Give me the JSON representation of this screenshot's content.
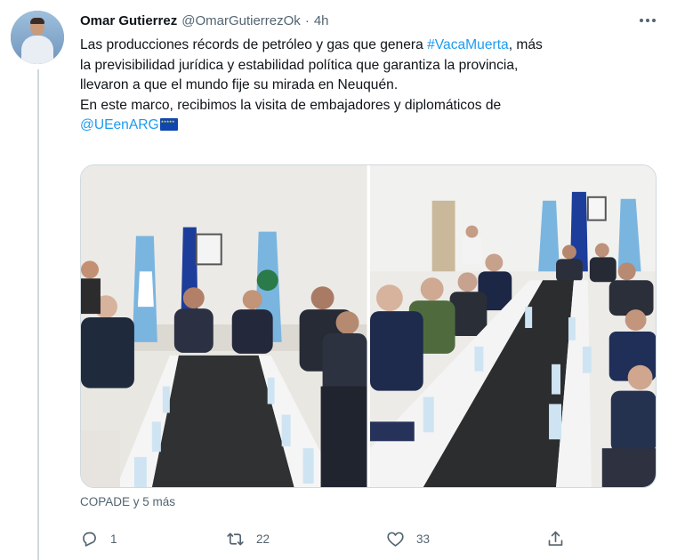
{
  "tweet": {
    "author_name": "Omar Gutierrez",
    "author_handle": "@OmarGutierrezOk",
    "separator": "·",
    "time": "4h",
    "text": {
      "l1_pre": "Las producciones récords de petróleo y gas que genera ",
      "hashtag": "#VacaMuerta",
      "l1_post": ", más",
      "l2": "la previsibilidad jurídica y estabilidad política que garantiza la provincia,",
      "l3": "llevaron a que el mundo fije su mirada en Neuquén.",
      "l4": "En este marco, recibimos la visita de embajadores y diplomáticos de",
      "mention": "@UEenARG"
    },
    "tagged_people": "COPADE y 5 más",
    "metrics": {
      "replies": "1",
      "retweets": "22",
      "likes": "33"
    }
  },
  "icons": {
    "more": "more-horizontal-icon",
    "reply": "reply-icon",
    "retweet": "retweet-icon",
    "like": "heart-icon",
    "share": "share-icon",
    "flag": "eu-flag-emoji"
  },
  "colors": {
    "link": "#1d9bf0",
    "text": "#0f1419",
    "secondary": "#536471",
    "border": "#cfd9de"
  }
}
